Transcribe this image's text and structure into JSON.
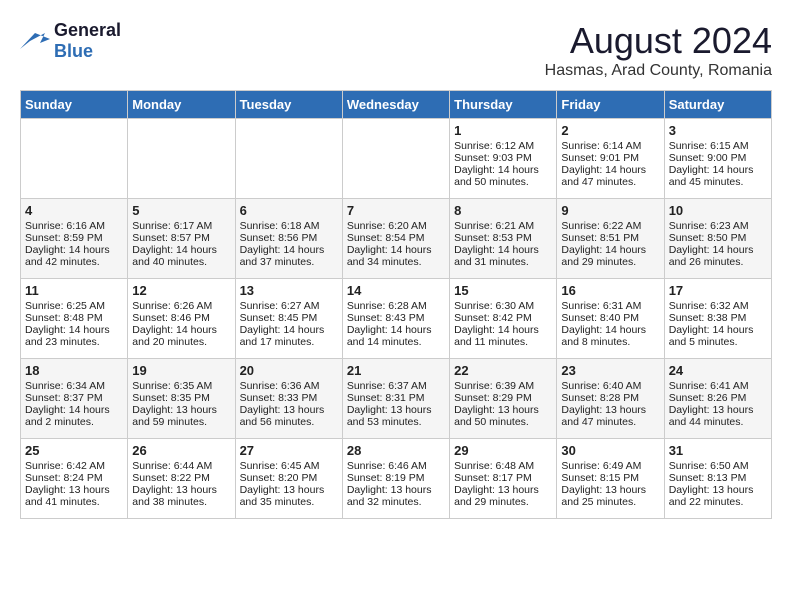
{
  "header": {
    "logo_general": "General",
    "logo_blue": "Blue",
    "month_year": "August 2024",
    "location": "Hasmas, Arad County, Romania"
  },
  "days_of_week": [
    "Sunday",
    "Monday",
    "Tuesday",
    "Wednesday",
    "Thursday",
    "Friday",
    "Saturday"
  ],
  "weeks": [
    [
      {
        "day": "",
        "info": ""
      },
      {
        "day": "",
        "info": ""
      },
      {
        "day": "",
        "info": ""
      },
      {
        "day": "",
        "info": ""
      },
      {
        "day": "1",
        "info": "Sunrise: 6:12 AM\nSunset: 9:03 PM\nDaylight: 14 hours and 50 minutes."
      },
      {
        "day": "2",
        "info": "Sunrise: 6:14 AM\nSunset: 9:01 PM\nDaylight: 14 hours and 47 minutes."
      },
      {
        "day": "3",
        "info": "Sunrise: 6:15 AM\nSunset: 9:00 PM\nDaylight: 14 hours and 45 minutes."
      }
    ],
    [
      {
        "day": "4",
        "info": "Sunrise: 6:16 AM\nSunset: 8:59 PM\nDaylight: 14 hours and 42 minutes."
      },
      {
        "day": "5",
        "info": "Sunrise: 6:17 AM\nSunset: 8:57 PM\nDaylight: 14 hours and 40 minutes."
      },
      {
        "day": "6",
        "info": "Sunrise: 6:18 AM\nSunset: 8:56 PM\nDaylight: 14 hours and 37 minutes."
      },
      {
        "day": "7",
        "info": "Sunrise: 6:20 AM\nSunset: 8:54 PM\nDaylight: 14 hours and 34 minutes."
      },
      {
        "day": "8",
        "info": "Sunrise: 6:21 AM\nSunset: 8:53 PM\nDaylight: 14 hours and 31 minutes."
      },
      {
        "day": "9",
        "info": "Sunrise: 6:22 AM\nSunset: 8:51 PM\nDaylight: 14 hours and 29 minutes."
      },
      {
        "day": "10",
        "info": "Sunrise: 6:23 AM\nSunset: 8:50 PM\nDaylight: 14 hours and 26 minutes."
      }
    ],
    [
      {
        "day": "11",
        "info": "Sunrise: 6:25 AM\nSunset: 8:48 PM\nDaylight: 14 hours and 23 minutes."
      },
      {
        "day": "12",
        "info": "Sunrise: 6:26 AM\nSunset: 8:46 PM\nDaylight: 14 hours and 20 minutes."
      },
      {
        "day": "13",
        "info": "Sunrise: 6:27 AM\nSunset: 8:45 PM\nDaylight: 14 hours and 17 minutes."
      },
      {
        "day": "14",
        "info": "Sunrise: 6:28 AM\nSunset: 8:43 PM\nDaylight: 14 hours and 14 minutes."
      },
      {
        "day": "15",
        "info": "Sunrise: 6:30 AM\nSunset: 8:42 PM\nDaylight: 14 hours and 11 minutes."
      },
      {
        "day": "16",
        "info": "Sunrise: 6:31 AM\nSunset: 8:40 PM\nDaylight: 14 hours and 8 minutes."
      },
      {
        "day": "17",
        "info": "Sunrise: 6:32 AM\nSunset: 8:38 PM\nDaylight: 14 hours and 5 minutes."
      }
    ],
    [
      {
        "day": "18",
        "info": "Sunrise: 6:34 AM\nSunset: 8:37 PM\nDaylight: 14 hours and 2 minutes."
      },
      {
        "day": "19",
        "info": "Sunrise: 6:35 AM\nSunset: 8:35 PM\nDaylight: 13 hours and 59 minutes."
      },
      {
        "day": "20",
        "info": "Sunrise: 6:36 AM\nSunset: 8:33 PM\nDaylight: 13 hours and 56 minutes."
      },
      {
        "day": "21",
        "info": "Sunrise: 6:37 AM\nSunset: 8:31 PM\nDaylight: 13 hours and 53 minutes."
      },
      {
        "day": "22",
        "info": "Sunrise: 6:39 AM\nSunset: 8:29 PM\nDaylight: 13 hours and 50 minutes."
      },
      {
        "day": "23",
        "info": "Sunrise: 6:40 AM\nSunset: 8:28 PM\nDaylight: 13 hours and 47 minutes."
      },
      {
        "day": "24",
        "info": "Sunrise: 6:41 AM\nSunset: 8:26 PM\nDaylight: 13 hours and 44 minutes."
      }
    ],
    [
      {
        "day": "25",
        "info": "Sunrise: 6:42 AM\nSunset: 8:24 PM\nDaylight: 13 hours and 41 minutes."
      },
      {
        "day": "26",
        "info": "Sunrise: 6:44 AM\nSunset: 8:22 PM\nDaylight: 13 hours and 38 minutes."
      },
      {
        "day": "27",
        "info": "Sunrise: 6:45 AM\nSunset: 8:20 PM\nDaylight: 13 hours and 35 minutes."
      },
      {
        "day": "28",
        "info": "Sunrise: 6:46 AM\nSunset: 8:19 PM\nDaylight: 13 hours and 32 minutes."
      },
      {
        "day": "29",
        "info": "Sunrise: 6:48 AM\nSunset: 8:17 PM\nDaylight: 13 hours and 29 minutes."
      },
      {
        "day": "30",
        "info": "Sunrise: 6:49 AM\nSunset: 8:15 PM\nDaylight: 13 hours and 25 minutes."
      },
      {
        "day": "31",
        "info": "Sunrise: 6:50 AM\nSunset: 8:13 PM\nDaylight: 13 hours and 22 minutes."
      }
    ]
  ]
}
